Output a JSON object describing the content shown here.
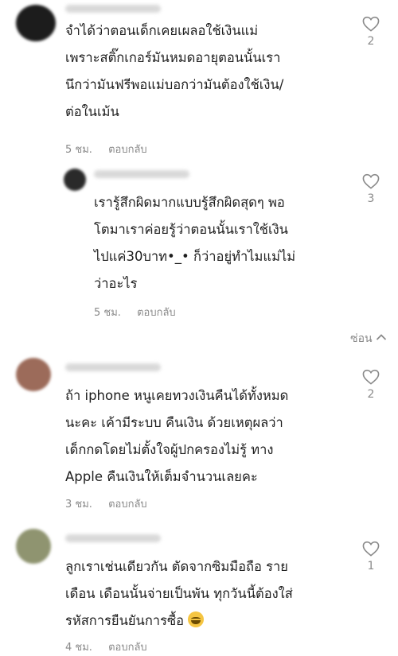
{
  "comments": [
    {
      "lines": [
        "จำได้ว่าตอนเด็กเคยเผลอใช้เงินแม่",
        "เพราะสติ๊กเกอร์มันหมดอายุตอนนั้นเรา",
        "นึกว่ามันฟรีพอแม่บอกว่ามันต้องใช้เงิน/",
        "ต่อในเม้น"
      ],
      "time": "5 ชม.",
      "reply": "ตอบกลับ",
      "likes": "2",
      "avatar_color": "#1c1c1c"
    },
    {
      "lines": [
        "เรารู้สึกผิดมากแบบรู้สึกผิดสุดๆ พอ",
        "โตมาเราค่อยรู้ว่าตอนนั้นเราใช้เงิน",
        "ไปแค่30บาท•_•  ก็ว่าอยู่ทำไมแม่ไม่",
        "ว่าอะไร"
      ],
      "time": "5 ชม.",
      "reply": "ตอบกลับ",
      "likes": "3",
      "avatar_color": "#2a2a2a"
    },
    {
      "lines": [
        "ถ้า iphone หนูเคยทวงเงินคืนได้ทั้งหมด",
        "นะคะ เค้ามีระบบ คืนเงิน ด้วยเหตุผลว่า",
        "เด็กกดโดยไม่ตั้งใจผู้ปกครองไม่รู้ ทาง",
        "Apple คืนเงินให้เต็มจำนวนเลยคะ"
      ],
      "time": "3 ชม.",
      "reply": "ตอบกลับ",
      "likes": "2",
      "avatar_color": "#9c6b5a"
    },
    {
      "lines": [
        "ลูกเราเช่นเดียวกัน ตัดจากซิมมือถือ ราย",
        "เดือน เดือนนั้นจ่ายเป็นพัน ทุกวันนี้ต้องใส่",
        "รหัสการยืนยันการซื้อ"
      ],
      "time": "4 ชม.",
      "reply": "ตอบกลับ",
      "likes": "1",
      "avatar_color": "#8f9470"
    }
  ],
  "hide_label": "ซ่อน",
  "emoji_name": "grinning-sweat-emoji"
}
